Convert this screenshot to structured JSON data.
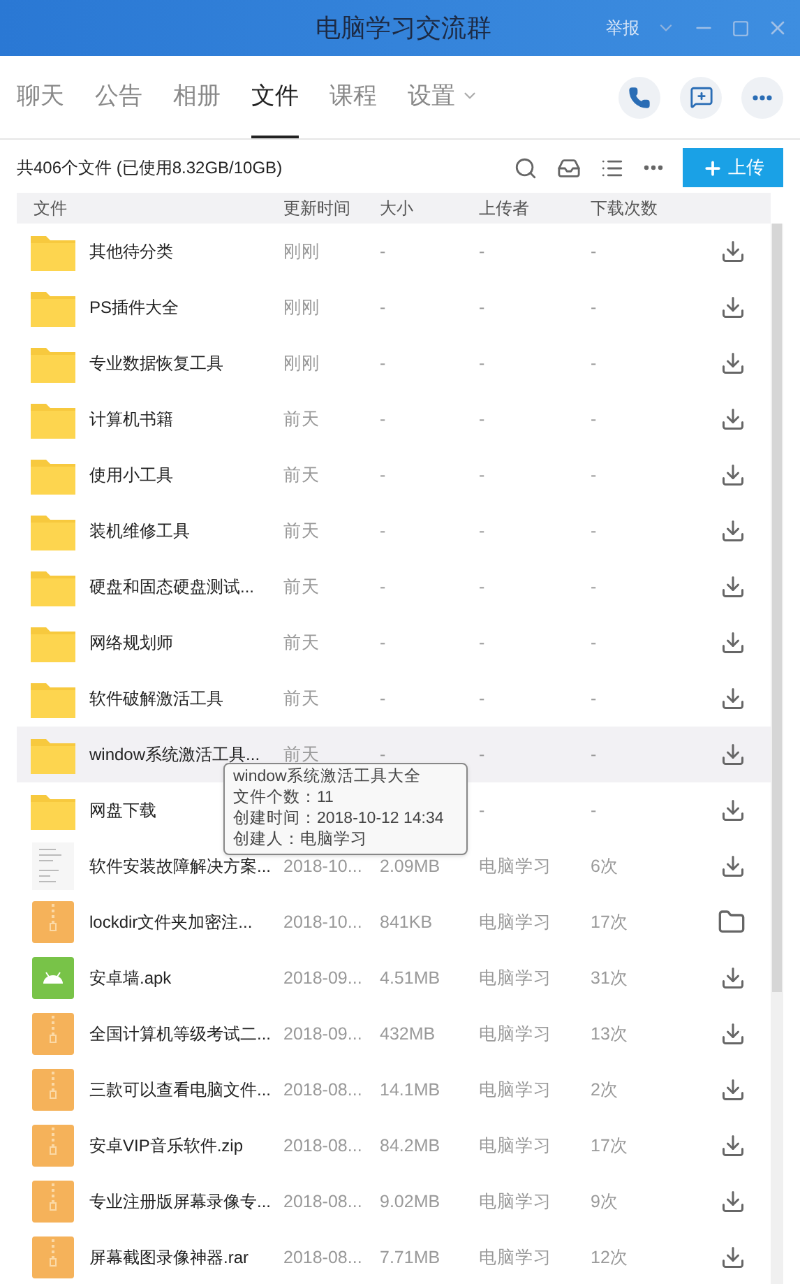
{
  "window": {
    "title": "电脑学习交流群",
    "report": "举报"
  },
  "tabs": [
    {
      "label": "聊天",
      "selected": false
    },
    {
      "label": "公告",
      "selected": false
    },
    {
      "label": "相册",
      "selected": false
    },
    {
      "label": "文件",
      "selected": true
    },
    {
      "label": "课程",
      "selected": false
    },
    {
      "label": "设置",
      "selected": false,
      "dropdown": true
    }
  ],
  "summary": "共406个文件 (已使用8.32GB/10GB)",
  "upload_button": "上传",
  "table": {
    "columns": [
      "文件",
      "更新时间",
      "大小",
      "上传者",
      "下载次数"
    ],
    "rows": [
      {
        "kind": "folder",
        "name": "其他待分类",
        "time": "刚刚",
        "size": "-",
        "uploader": "-",
        "downloads": "-",
        "action": {
          "kind": "download"
        },
        "hovered": false
      },
      {
        "kind": "folder",
        "name": "PS插件大全",
        "time": "刚刚",
        "size": "-",
        "uploader": "-",
        "downloads": "-",
        "action": {
          "kind": "download"
        },
        "hovered": false
      },
      {
        "kind": "folder",
        "name": "专业数据恢复工具",
        "time": "刚刚",
        "size": "-",
        "uploader": "-",
        "downloads": "-",
        "action": {
          "kind": "download"
        },
        "hovered": false
      },
      {
        "kind": "folder",
        "name": "计算机书籍",
        "time": "前天",
        "size": "-",
        "uploader": "-",
        "downloads": "-",
        "action": {
          "kind": "download"
        },
        "hovered": false
      },
      {
        "kind": "folder",
        "name": "使用小工具",
        "time": "前天",
        "size": "-",
        "uploader": "-",
        "downloads": "-",
        "action": {
          "kind": "download"
        },
        "hovered": false
      },
      {
        "kind": "folder",
        "name": "装机维修工具",
        "time": "前天",
        "size": "-",
        "uploader": "-",
        "downloads": "-",
        "action": {
          "kind": "download"
        },
        "hovered": false
      },
      {
        "kind": "folder",
        "name": "硬盘和固态硬盘测试...",
        "time": "前天",
        "size": "-",
        "uploader": "-",
        "downloads": "-",
        "action": {
          "kind": "download"
        },
        "hovered": false
      },
      {
        "kind": "folder",
        "name": "网络规划师",
        "time": "前天",
        "size": "-",
        "uploader": "-",
        "downloads": "-",
        "action": {
          "kind": "download"
        },
        "hovered": false
      },
      {
        "kind": "folder",
        "name": "软件破解激活工具",
        "time": "前天",
        "size": "-",
        "uploader": "-",
        "downloads": "-",
        "action": {
          "kind": "download"
        },
        "hovered": false
      },
      {
        "kind": "folder",
        "name": "window系统激活工具...",
        "time": "前天",
        "size": "-",
        "uploader": "-",
        "downloads": "-",
        "action": {
          "kind": "download"
        },
        "hovered": true
      },
      {
        "kind": "folder",
        "name": "网盘下载",
        "uploader": "-",
        "downloads": "-",
        "action": {
          "kind": "download"
        },
        "hovered": false
      },
      {
        "kind": "document",
        "name": "软件安装故障解决方案...",
        "time": "2018-10...",
        "size": "2.09MB",
        "uploader": "电脑学习",
        "downloads": "6次",
        "action": {
          "kind": "download"
        },
        "hovered": false
      },
      {
        "kind": "archive",
        "name": "lockdir文件夹加密注...",
        "time": "2018-10...",
        "size": "841KB",
        "uploader": "电脑学习",
        "downloads": "17次",
        "action": {
          "kind": "open-folder"
        },
        "hovered": false
      },
      {
        "kind": "apk",
        "name": "安卓墙.apk",
        "time": "2018-09...",
        "size": "4.51MB",
        "uploader": "电脑学习",
        "downloads": "31次",
        "action": {
          "kind": "download"
        },
        "hovered": false
      },
      {
        "kind": "archive",
        "name": "全国计算机等级考试二...",
        "time": "2018-09...",
        "size": "432MB",
        "uploader": "电脑学习",
        "downloads": "13次",
        "action": {
          "kind": "download"
        },
        "hovered": false
      },
      {
        "kind": "archive",
        "name": "三款可以查看电脑文件...",
        "time": "2018-08...",
        "size": "14.1MB",
        "uploader": "电脑学习",
        "downloads": "2次",
        "action": {
          "kind": "download"
        },
        "hovered": false
      },
      {
        "kind": "archive",
        "name": "安卓VIP音乐软件.zip",
        "time": "2018-08...",
        "size": "84.2MB",
        "uploader": "电脑学习",
        "downloads": "17次",
        "action": {
          "kind": "download"
        },
        "hovered": false
      },
      {
        "kind": "archive",
        "name": "专业注册版屏幕录像专...",
        "time": "2018-08...",
        "size": "9.02MB",
        "uploader": "电脑学习",
        "downloads": "9次",
        "action": {
          "kind": "download"
        },
        "hovered": false
      },
      {
        "kind": "archive",
        "name": "屏幕截图录像神器.rar",
        "time": "2018-08...",
        "size": "7.71MB",
        "uploader": "电脑学习",
        "downloads": "12次",
        "action": {
          "kind": "download"
        },
        "hovered": false
      }
    ]
  },
  "tooltip": {
    "lines": [
      "window系统激活工具大全",
      "文件个数：11",
      "创建时间：2018-10-12 14:34",
      "创建人：电脑学习"
    ]
  }
}
